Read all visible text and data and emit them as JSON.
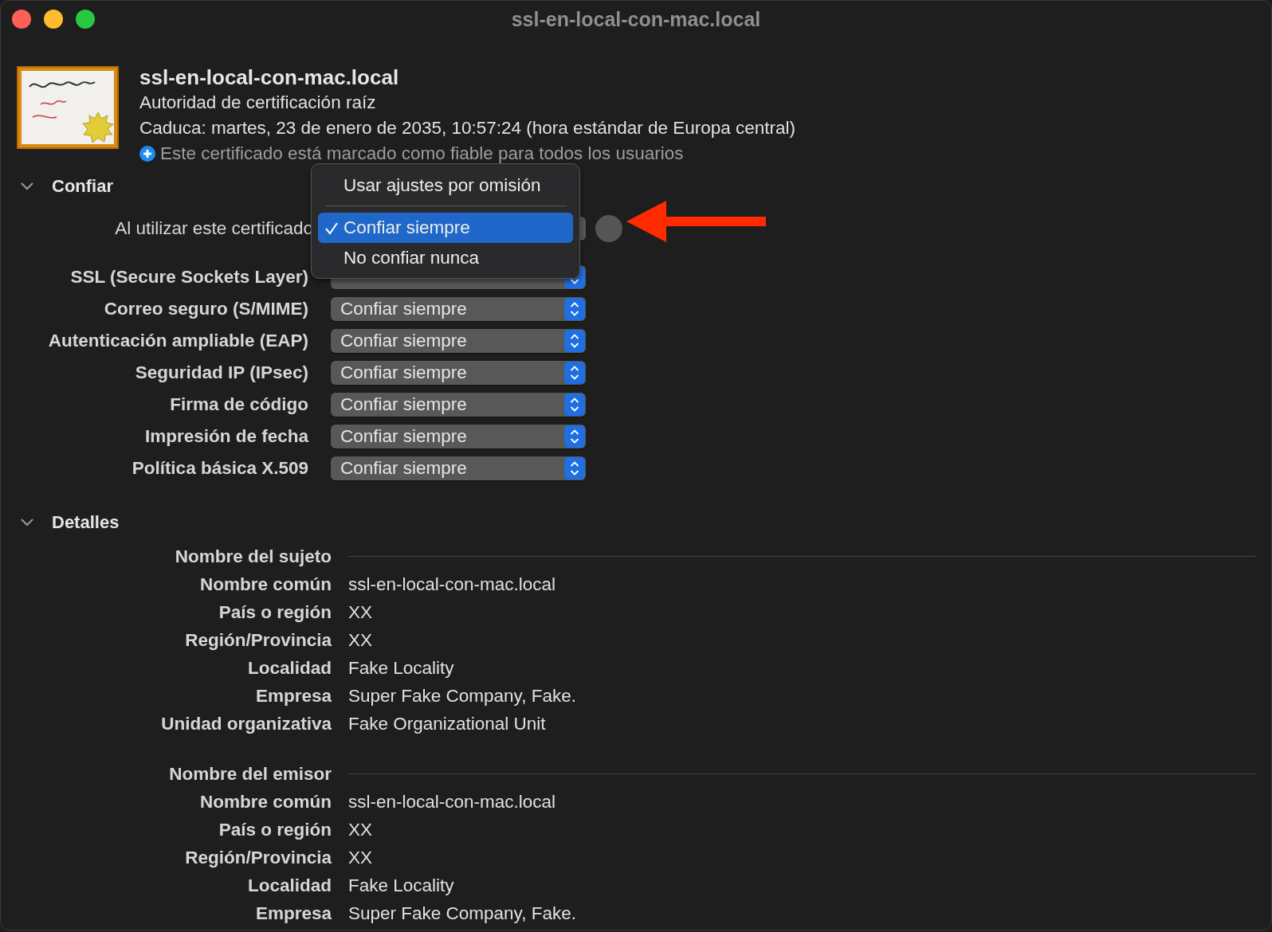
{
  "window": {
    "title": "ssl-en-local-con-mac.local"
  },
  "certificate": {
    "name": "ssl-en-local-con-mac.local",
    "type": "Autoridad de certificación raíz",
    "expires": "Caduca: martes, 23 de enero de 2035, 10:57:24 (hora estándar de Europa central)",
    "trust_note": "Este certificado está marcado como fiable para todos los usuarios"
  },
  "trust": {
    "title": "Confiar",
    "expanded": true,
    "when_using_label": "Al utilizar este certificado",
    "policies": [
      {
        "label": "SSL (Secure Sockets Layer)"
      },
      {
        "label": "Correo seguro (S/MIME)",
        "value": "Confiar siempre"
      },
      {
        "label": "Autenticación ampliable (EAP)",
        "value": "Confiar siempre"
      },
      {
        "label": "Seguridad IP (IPsec)",
        "value": "Confiar siempre"
      },
      {
        "label": "Firma de código",
        "value": "Confiar siempre"
      },
      {
        "label": "Impresión de fecha",
        "value": "Confiar siempre"
      },
      {
        "label": "Política básica X.509",
        "value": "Confiar siempre"
      }
    ]
  },
  "menu": {
    "items": [
      {
        "kind": "option",
        "label": "Usar ajustes por omisión",
        "selected": false
      },
      {
        "kind": "separator"
      },
      {
        "kind": "option",
        "label": "Confiar siempre",
        "selected": true
      },
      {
        "kind": "option",
        "label": "No confiar nunca",
        "selected": false
      }
    ]
  },
  "details": {
    "title": "Detalles",
    "expanded": true,
    "groups": [
      {
        "heading": "Nombre del sujeto",
        "rows": [
          {
            "label": "Nombre común",
            "value": "ssl-en-local-con-mac.local"
          },
          {
            "label": "País o región",
            "value": "XX"
          },
          {
            "label": "Región/Provincia",
            "value": "XX"
          },
          {
            "label": "Localidad",
            "value": "Fake Locality"
          },
          {
            "label": "Empresa",
            "value": "Super Fake Company, Fake."
          },
          {
            "label": "Unidad organizativa",
            "value": "Fake Organizational Unit"
          }
        ]
      },
      {
        "heading": "Nombre del emisor",
        "rows": [
          {
            "label": "Nombre común",
            "value": "ssl-en-local-con-mac.local"
          },
          {
            "label": "País o región",
            "value": "XX"
          },
          {
            "label": "Región/Provincia",
            "value": "XX"
          },
          {
            "label": "Localidad",
            "value": "Fake Locality"
          },
          {
            "label": "Empresa",
            "value": "Super Fake Company, Fake."
          }
        ]
      }
    ]
  }
}
